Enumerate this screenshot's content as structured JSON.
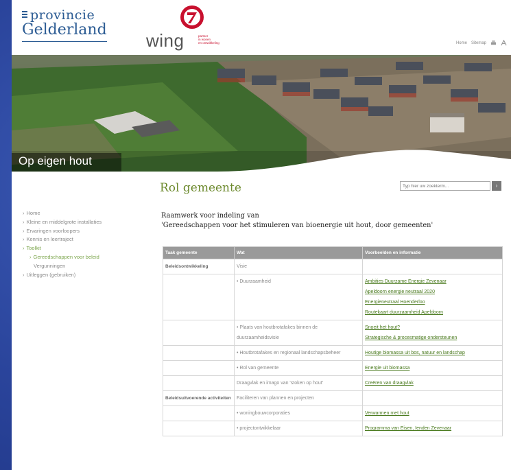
{
  "header": {
    "prov_line1": "provincie",
    "prov_line2": "Gelderland",
    "wing_word": "wing",
    "wing_tag1": "partner",
    "wing_tag2": "in wonen",
    "wing_tag3": "en ontwikkeling",
    "util_home": "Home",
    "util_sitemap": "Sitemap"
  },
  "banner": {
    "title": "Op eigen hout"
  },
  "sidebar": {
    "items": [
      {
        "label": "Home"
      },
      {
        "label": "Kleine en middelgrote installaties"
      },
      {
        "label": "Ervaringen voorloopers"
      },
      {
        "label": "Kennis en leertraject"
      },
      {
        "label": "Toolkit"
      },
      {
        "label": "Gereedschappen voor beleid"
      },
      {
        "label": "Vergunningen"
      },
      {
        "label": "Uitleggen (gebruiken)"
      }
    ]
  },
  "main": {
    "title": "Rol gemeente",
    "search_placeholder": "Typ hier uw zoekterm...",
    "intro_line1": "Raamwerk voor indeling van",
    "intro_line2": "'Gereedschappen voor het stimuleren van bioenergie uit hout, door gemeenten'",
    "table": {
      "headers": [
        "Taak gemeente",
        "Wat",
        "Voorbeelden en informatie"
      ],
      "rows": [
        {
          "task": "Beleidsontwikkeling",
          "what": "Visie",
          "links": []
        },
        {
          "task": "",
          "what": "• Duurzaamheid",
          "links": [
            "Ambities Duurzame Energie Zevenaar",
            "Apeldoorn energie neutraal 2020",
            "Energieneutraal Hoenderloo",
            "Routekaart duurzaamheid Apeldoorn"
          ]
        },
        {
          "task": "",
          "what": "• Plaats van houtbrotafakes binnen de duurzaamheidsvisie",
          "links": [
            "Snoeit het hout?",
            "Strategische & procesmatige ondersteunen"
          ]
        },
        {
          "task": "",
          "what": "• Houtbrotafakes en regionaal landschapsbeheer",
          "links": [
            "Houtige biomassa uit bos, natuur en landschap"
          ]
        },
        {
          "task": "",
          "what": "• Rol van gemeente",
          "links": [
            "Energie uit biomassa"
          ]
        },
        {
          "task": "",
          "what": "Draagvlak en imago van 'stoken op hout'",
          "links": [
            "Creëren van draagvlak"
          ]
        },
        {
          "task": "Beleidsuitvoerende activiteiten",
          "what": "Faciliteren van plannen en projecten",
          "links": []
        },
        {
          "task": "",
          "what": "• woningbouwcorporaties",
          "links": [
            "Verwarmen met hout"
          ]
        },
        {
          "task": "",
          "what": "• projectontwikkelaar",
          "links": [
            "Programma van Eisen, Ienden Zevenaar"
          ]
        }
      ]
    }
  },
  "colors": {
    "accent_green": "#6d8a2e",
    "brand_blue": "#2b5b93",
    "wing_red": "#c8102e",
    "table_header": "#9a9a9a"
  }
}
